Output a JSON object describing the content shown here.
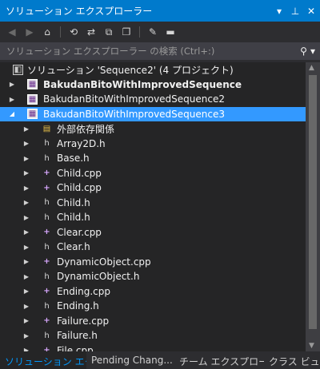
{
  "titlebar": {
    "title": "ソリューション エクスプローラー",
    "icons": [
      "dropdown-icon",
      "pin-icon",
      "close-icon"
    ]
  },
  "toolbar": {
    "buttons": [
      "back-icon",
      "forward-icon",
      "home-icon",
      "sync-icon",
      "refresh-icon",
      "collapse-icon",
      "show-all-files-icon",
      "properties-icon",
      "preview-icon"
    ]
  },
  "search": {
    "placeholder": "ソリューション エクスプローラー の検索 (Ctrl+:)"
  },
  "tree": {
    "solution": "ソリューション 'Sequence2' (4 プロジェクト)",
    "project1": "BakudanBitoWithImprovedSequence",
    "project2": "BakudanBitoWithImprovedSequence2",
    "project3": "BakudanBitoWithImprovedSequence3",
    "external_deps": "外部依存関係",
    "files": [
      {
        "name": "Array2D.h",
        "type": "h"
      },
      {
        "name": "Base.h",
        "type": "h"
      },
      {
        "name": "Child.cpp",
        "type": "cpp"
      },
      {
        "name": "Child.cpp",
        "type": "cpp"
      },
      {
        "name": "Child.h",
        "type": "h"
      },
      {
        "name": "Child.h",
        "type": "h"
      },
      {
        "name": "Clear.cpp",
        "type": "cpp"
      },
      {
        "name": "Clear.h",
        "type": "h"
      },
      {
        "name": "DynamicObject.cpp",
        "type": "cpp"
      },
      {
        "name": "DynamicObject.h",
        "type": "h"
      },
      {
        "name": "Ending.cpp",
        "type": "cpp"
      },
      {
        "name": "Ending.h",
        "type": "h"
      },
      {
        "name": "Failure.cpp",
        "type": "cpp"
      },
      {
        "name": "Failure.h",
        "type": "h"
      },
      {
        "name": "File.cpp",
        "type": "cpp"
      }
    ]
  },
  "tabs": {
    "tab1": "ソリューション エク...",
    "tab2": "Pending Chang...",
    "tab3": "チーム エクスプロー...",
    "tab4": "クラス ビュー"
  },
  "colors": {
    "accent": "#007acc",
    "selection": "#3399ff",
    "background": "#252526"
  }
}
